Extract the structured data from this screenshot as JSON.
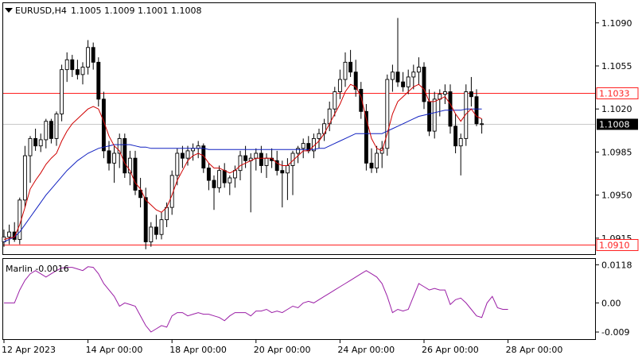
{
  "header": {
    "symbol_tf": "EURUSD,H4",
    "ohlc": "1.1005 1.1009 1.1001 1.1008"
  },
  "indicator": {
    "label": "Marlin -0.0016"
  },
  "colors": {
    "bull": "#ffffff",
    "bear": "#000000",
    "ema_red": "#d00000",
    "ma_blue": "#1020c0",
    "marlin": "#9b1fa6",
    "level": "#ff2020",
    "current_tag_bg": "#000000"
  },
  "chart_data": {
    "type": "candlestick",
    "instrument": "EURUSD",
    "timeframe": "H4",
    "price_axis": {
      "ticks": [
        1.109,
        1.1055,
        1.102,
        1.0985,
        1.095,
        1.0915
      ],
      "tick_labels": [
        "1.1090",
        "1.1055",
        "1.1020",
        "1.0985",
        "1.0950",
        "1.0915"
      ]
    },
    "time_axis": {
      "labels": [
        "12 Apr 2023",
        "14 Apr 00:00",
        "18 Apr 00:00",
        "20 Apr 00:00",
        "24 Apr 00:00",
        "26 Apr 00:00",
        "28 Apr 00:00"
      ],
      "label_bar_index": [
        0,
        16,
        32,
        48,
        64,
        80,
        96
      ]
    },
    "levels": [
      {
        "price": 1.1033,
        "label": "1.1033",
        "style": "red-outline"
      },
      {
        "price": 1.091,
        "label": "1.0910",
        "style": "red-outline"
      }
    ],
    "current_price": {
      "price": 1.1008,
      "label": "1.1008"
    },
    "candles": [
      [
        1.0912,
        1.0922,
        1.0908,
        1.0916
      ],
      [
        1.0916,
        1.0926,
        1.091,
        1.092
      ],
      [
        1.092,
        1.0928,
        1.0912,
        1.0914
      ],
      [
        1.0914,
        1.0948,
        1.091,
        1.0946
      ],
      [
        1.0946,
        1.099,
        1.094,
        1.0982
      ],
      [
        1.0982,
        1.0998,
        1.096,
        1.0996
      ],
      [
        1.0996,
        1.1004,
        1.0986,
        1.099
      ],
      [
        1.099,
        1.1,
        1.0985,
        1.0995
      ],
      [
        1.0995,
        1.1012,
        1.0988,
        1.101
      ],
      [
        1.101,
        1.1012,
        1.0992,
        1.0996
      ],
      [
        1.0996,
        1.1018,
        1.099,
        1.1016
      ],
      [
        1.1016,
        1.1056,
        1.101,
        1.1052
      ],
      [
        1.1052,
        1.1066,
        1.1042,
        1.106
      ],
      [
        1.106,
        1.1064,
        1.1046,
        1.1052
      ],
      [
        1.1052,
        1.106,
        1.1044,
        1.1048
      ],
      [
        1.1048,
        1.1058,
        1.104,
        1.1054
      ],
      [
        1.1054,
        1.1076,
        1.1048,
        1.107
      ],
      [
        1.107,
        1.1074,
        1.1052,
        1.1058
      ],
      [
        1.1058,
        1.1062,
        1.1022,
        1.1028
      ],
      [
        1.1028,
        1.1034,
        1.098,
        1.0986
      ],
      [
        1.0986,
        1.0994,
        1.097,
        1.0976
      ],
      [
        1.0976,
        1.099,
        1.096,
        1.0984
      ],
      [
        1.0984,
        1.1,
        1.0972,
        1.0996
      ],
      [
        1.0996,
        1.1,
        1.0964,
        1.0968
      ],
      [
        1.0968,
        1.0986,
        1.0958,
        1.098
      ],
      [
        1.098,
        1.0986,
        1.095,
        1.0954
      ],
      [
        1.0954,
        1.0964,
        1.094,
        1.0948
      ],
      [
        1.0948,
        1.0956,
        1.0906,
        1.0912
      ],
      [
        1.0912,
        1.0928,
        1.0908,
        1.0924
      ],
      [
        1.0924,
        1.0934,
        1.0914,
        1.0918
      ],
      [
        1.0918,
        1.0936,
        1.0914,
        1.093
      ],
      [
        1.093,
        1.0944,
        1.0924,
        1.094
      ],
      [
        1.094,
        1.097,
        1.0934,
        1.0966
      ],
      [
        1.0966,
        1.0988,
        1.0958,
        1.0984
      ],
      [
        1.0984,
        1.099,
        1.0972,
        1.098
      ],
      [
        1.098,
        1.099,
        1.0974,
        1.0986
      ],
      [
        1.0986,
        1.0992,
        1.0978,
        1.0988
      ],
      [
        1.0988,
        1.0994,
        1.098,
        1.099
      ],
      [
        1.099,
        1.0992,
        1.0968,
        1.0972
      ],
      [
        1.0972,
        1.0976,
        1.0954,
        1.0962
      ],
      [
        1.0962,
        1.0966,
        1.0938,
        1.0956
      ],
      [
        1.0956,
        1.0974,
        1.0952,
        1.097
      ],
      [
        1.097,
        1.0976,
        1.0956,
        1.096
      ],
      [
        1.096,
        1.0966,
        1.095,
        1.0964
      ],
      [
        1.0964,
        1.0974,
        1.0956,
        1.097
      ],
      [
        1.097,
        1.0986,
        1.0962,
        1.0982
      ],
      [
        1.0982,
        1.099,
        1.0972,
        1.0978
      ],
      [
        1.0978,
        1.0984,
        1.0936,
        1.098
      ],
      [
        1.098,
        1.0988,
        1.097,
        1.0984
      ],
      [
        1.0984,
        1.099,
        1.0968,
        1.0974
      ],
      [
        1.0974,
        1.0984,
        1.0964,
        1.098
      ],
      [
        1.098,
        1.0988,
        1.0972,
        1.0978
      ],
      [
        1.0978,
        1.0986,
        1.0966,
        1.097
      ],
      [
        1.097,
        1.0978,
        1.094,
        1.0968
      ],
      [
        1.0968,
        1.098,
        1.0946,
        1.0974
      ],
      [
        1.0974,
        1.0986,
        1.095,
        1.0984
      ],
      [
        1.0984,
        1.099,
        1.0976,
        1.0988
      ],
      [
        1.0988,
        1.0996,
        1.098,
        1.0992
      ],
      [
        1.0992,
        1.0998,
        1.0984,
        1.0986
      ],
      [
        1.0986,
        1.1,
        1.098,
        1.0996
      ],
      [
        1.0996,
        1.1004,
        1.0988,
        1.1
      ],
      [
        1.1,
        1.1012,
        1.0994,
        1.1008
      ],
      [
        1.1008,
        1.1026,
        1.1002,
        1.102
      ],
      [
        1.102,
        1.1038,
        1.1014,
        1.1034
      ],
      [
        1.1034,
        1.1052,
        1.1028,
        1.1044
      ],
      [
        1.1044,
        1.1066,
        1.1038,
        1.1058
      ],
      [
        1.1058,
        1.1068,
        1.1046,
        1.105
      ],
      [
        1.105,
        1.106,
        1.103,
        1.1036
      ],
      [
        1.1036,
        1.1042,
        1.1012,
        1.1018
      ],
      [
        1.1018,
        1.1024,
        1.097,
        1.0976
      ],
      [
        1.0976,
        1.0988,
        1.0968,
        1.0972
      ],
      [
        1.0972,
        1.099,
        1.0968,
        1.0984
      ],
      [
        1.0984,
        1.0994,
        1.0972,
        1.0988
      ],
      [
        1.0988,
        1.1048,
        1.0982,
        1.1044
      ],
      [
        1.1044,
        1.1056,
        1.1034,
        1.105
      ],
      [
        1.105,
        1.1094,
        1.1038,
        1.1042
      ],
      [
        1.1042,
        1.105,
        1.1034,
        1.1038
      ],
      [
        1.1038,
        1.1052,
        1.1032,
        1.1046
      ],
      [
        1.1046,
        1.1056,
        1.1036,
        1.105
      ],
      [
        1.105,
        1.1062,
        1.104,
        1.1054
      ],
      [
        1.1054,
        1.1058,
        1.102,
        1.1026
      ],
      [
        1.1026,
        1.1036,
        1.0998,
        1.1002
      ],
      [
        1.1002,
        1.1034,
        1.0996,
        1.1028
      ],
      [
        1.1028,
        1.1036,
        1.1014,
        1.1032
      ],
      [
        1.1032,
        1.104,
        1.1024,
        1.1034
      ],
      [
        1.1034,
        1.104,
        1.1,
        1.1006
      ],
      [
        1.1006,
        1.1016,
        1.0984,
        1.099
      ],
      [
        1.099,
        1.1,
        1.0966,
        1.0996
      ],
      [
        1.0996,
        1.104,
        1.099,
        1.1034
      ],
      [
        1.1034,
        1.1046,
        1.1022,
        1.103
      ],
      [
        1.103,
        1.1036,
        1.1006,
        1.1008
      ],
      [
        1.1008,
        1.1012,
        1.1,
        1.1008
      ]
    ],
    "ema_red": [
      1.0914,
      1.0915,
      1.0916,
      1.0926,
      1.094,
      1.0955,
      1.0962,
      1.0968,
      1.0975,
      1.098,
      1.0984,
      1.0994,
      1.1002,
      1.1008,
      1.1012,
      1.1016,
      1.102,
      1.1022,
      1.102,
      1.101,
      1.0998,
      1.099,
      1.0986,
      1.0976,
      1.097,
      1.096,
      1.0955,
      1.0946,
      1.0942,
      1.0938,
      1.0936,
      1.094,
      1.095,
      1.0962,
      1.097,
      1.0978,
      1.0982,
      1.0984,
      1.0982,
      1.0976,
      1.0972,
      1.0972,
      1.097,
      1.0968,
      1.097,
      1.0974,
      1.0976,
      1.0978,
      1.098,
      1.098,
      1.098,
      1.098,
      1.0976,
      1.0974,
      1.0974,
      1.0978,
      1.0982,
      1.0986,
      1.0986,
      1.099,
      1.0994,
      1.1,
      1.1008,
      1.1016,
      1.1024,
      1.1034,
      1.104,
      1.1038,
      1.103,
      1.1012,
      1.0996,
      1.0988,
      1.0986,
      1.1,
      1.1016,
      1.1026,
      1.103,
      1.1034,
      1.1038,
      1.104,
      1.1036,
      1.1026,
      1.1026,
      1.1028,
      1.103,
      1.1024,
      1.1016,
      1.101,
      1.1016,
      1.102,
      1.1014,
      1.1012
    ],
    "ma_blue": [
      1.0912,
      1.0914,
      1.0916,
      1.092,
      1.0926,
      1.0932,
      1.0938,
      1.0944,
      1.095,
      1.0955,
      1.096,
      1.0965,
      1.097,
      1.0974,
      1.0978,
      1.0981,
      1.0984,
      1.0986,
      1.0988,
      1.0989,
      1.099,
      1.0991,
      1.0991,
      1.0991,
      1.0991,
      1.099,
      1.0989,
      1.0989,
      1.0988,
      1.0988,
      1.0988,
      1.0988,
      1.0988,
      1.0988,
      1.0988,
      1.0988,
      1.0988,
      1.0988,
      1.0988,
      1.0987,
      1.0987,
      1.0987,
      1.0987,
      1.0987,
      1.0987,
      1.0987,
      1.0987,
      1.0987,
      1.0987,
      1.0987,
      1.0987,
      1.0987,
      1.0987,
      1.0987,
      1.0987,
      1.0987,
      1.0987,
      1.0987,
      1.0987,
      1.0987,
      1.0988,
      1.0988,
      1.099,
      1.0992,
      1.0994,
      1.0996,
      1.0998,
      1.1,
      1.1,
      1.1,
      1.1,
      1.1,
      1.1,
      1.1002,
      1.1004,
      1.1006,
      1.1008,
      1.101,
      1.1012,
      1.1014,
      1.1015,
      1.1016,
      1.1017,
      1.1018,
      1.1019,
      1.1019,
      1.1019,
      1.1019,
      1.102,
      1.102,
      1.102,
      1.102
    ],
    "marlin": {
      "ticks": [
        0.0118,
        0.0,
        -0.009
      ],
      "tick_labels": [
        "0.0118",
        "0.00",
        "-0.009"
      ],
      "values": [
        0.0,
        0.0,
        0.0,
        0.004,
        0.007,
        0.009,
        0.01,
        0.009,
        0.008,
        0.009,
        0.01,
        0.0108,
        0.011,
        0.011,
        0.0105,
        0.01,
        0.0112,
        0.011,
        0.009,
        0.006,
        0.004,
        0.002,
        -0.001,
        0.0,
        -0.0005,
        -0.001,
        -0.004,
        -0.007,
        -0.009,
        -0.008,
        -0.007,
        -0.0075,
        -0.004,
        -0.003,
        -0.003,
        -0.004,
        -0.0035,
        -0.003,
        -0.0035,
        -0.0035,
        -0.004,
        -0.0045,
        -0.0055,
        -0.004,
        -0.003,
        -0.003,
        -0.003,
        -0.004,
        -0.0025,
        -0.0025,
        -0.002,
        -0.003,
        -0.0025,
        -0.003,
        -0.002,
        -0.001,
        -0.0015,
        0.0,
        0.0005,
        0.0,
        0.001,
        0.002,
        0.003,
        0.004,
        0.005,
        0.006,
        0.007,
        0.008,
        0.009,
        0.01,
        0.009,
        0.008,
        0.006,
        0.002,
        -0.003,
        -0.002,
        -0.0025,
        -0.002,
        0.002,
        0.006,
        0.005,
        0.004,
        0.0045,
        0.004,
        0.004,
        -0.0005,
        0.001,
        0.0015,
        0.0,
        -0.002,
        -0.004,
        -0.0045,
        0.0,
        0.002,
        -0.0015,
        -0.002,
        -0.002
      ]
    }
  }
}
